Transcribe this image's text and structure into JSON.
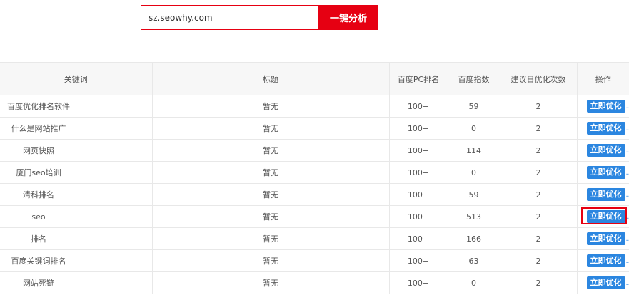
{
  "search": {
    "value": "sz.seowhy.com",
    "button_label": "一键分析"
  },
  "table": {
    "headers": [
      "关键词",
      "标题",
      "百度PC排名",
      "百度指数",
      "建议日优化次数",
      "操作"
    ],
    "rows": [
      {
        "keyword": "百度优化排名软件",
        "title": "暂无",
        "rank": "100+",
        "index": "59",
        "times": "2",
        "action": "立即优化"
      },
      {
        "keyword": "什么是网站推广",
        "title": "暂无",
        "rank": "100+",
        "index": "0",
        "times": "2",
        "action": "立即优化"
      },
      {
        "keyword": "网页快照",
        "title": "暂无",
        "rank": "100+",
        "index": "114",
        "times": "2",
        "action": "立即优化"
      },
      {
        "keyword": "厦门seo培训",
        "title": "暂无",
        "rank": "100+",
        "index": "0",
        "times": "2",
        "action": "立即优化"
      },
      {
        "keyword": "清科排名",
        "title": "暂无",
        "rank": "100+",
        "index": "59",
        "times": "2",
        "action": "立即优化"
      },
      {
        "keyword": "seo",
        "title": "暂无",
        "rank": "100+",
        "index": "513",
        "times": "2",
        "action": "立即优化"
      },
      {
        "keyword": "排名",
        "title": "暂无",
        "rank": "100+",
        "index": "166",
        "times": "2",
        "action": "立即优化"
      },
      {
        "keyword": "百度关键词排名",
        "title": "暂无",
        "rank": "100+",
        "index": "63",
        "times": "2",
        "action": "立即优化"
      },
      {
        "keyword": "网站死链",
        "title": "暂无",
        "rank": "100+",
        "index": "0",
        "times": "2",
        "action": "立即优化"
      }
    ]
  },
  "colors": {
    "accent_red": "#e60012",
    "button_blue": "#2b86e0"
  }
}
